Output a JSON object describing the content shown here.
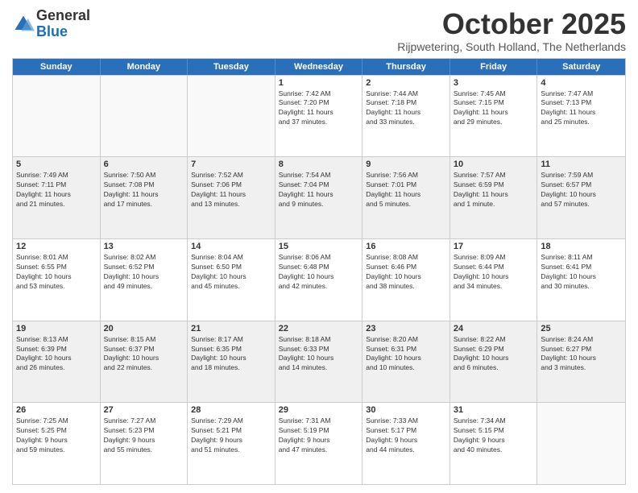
{
  "logo": {
    "general": "General",
    "blue": "Blue"
  },
  "title": "October 2025",
  "location": "Rijpwetering, South Holland, The Netherlands",
  "days": [
    "Sunday",
    "Monday",
    "Tuesday",
    "Wednesday",
    "Thursday",
    "Friday",
    "Saturday"
  ],
  "weeks": [
    [
      {
        "day": "",
        "content": ""
      },
      {
        "day": "",
        "content": ""
      },
      {
        "day": "",
        "content": ""
      },
      {
        "day": "1",
        "content": "Sunrise: 7:42 AM\nSunset: 7:20 PM\nDaylight: 11 hours\nand 37 minutes."
      },
      {
        "day": "2",
        "content": "Sunrise: 7:44 AM\nSunset: 7:18 PM\nDaylight: 11 hours\nand 33 minutes."
      },
      {
        "day": "3",
        "content": "Sunrise: 7:45 AM\nSunset: 7:15 PM\nDaylight: 11 hours\nand 29 minutes."
      },
      {
        "day": "4",
        "content": "Sunrise: 7:47 AM\nSunset: 7:13 PM\nDaylight: 11 hours\nand 25 minutes."
      }
    ],
    [
      {
        "day": "5",
        "content": "Sunrise: 7:49 AM\nSunset: 7:11 PM\nDaylight: 11 hours\nand 21 minutes."
      },
      {
        "day": "6",
        "content": "Sunrise: 7:50 AM\nSunset: 7:08 PM\nDaylight: 11 hours\nand 17 minutes."
      },
      {
        "day": "7",
        "content": "Sunrise: 7:52 AM\nSunset: 7:06 PM\nDaylight: 11 hours\nand 13 minutes."
      },
      {
        "day": "8",
        "content": "Sunrise: 7:54 AM\nSunset: 7:04 PM\nDaylight: 11 hours\nand 9 minutes."
      },
      {
        "day": "9",
        "content": "Sunrise: 7:56 AM\nSunset: 7:01 PM\nDaylight: 11 hours\nand 5 minutes."
      },
      {
        "day": "10",
        "content": "Sunrise: 7:57 AM\nSunset: 6:59 PM\nDaylight: 11 hours\nand 1 minute."
      },
      {
        "day": "11",
        "content": "Sunrise: 7:59 AM\nSunset: 6:57 PM\nDaylight: 10 hours\nand 57 minutes."
      }
    ],
    [
      {
        "day": "12",
        "content": "Sunrise: 8:01 AM\nSunset: 6:55 PM\nDaylight: 10 hours\nand 53 minutes."
      },
      {
        "day": "13",
        "content": "Sunrise: 8:02 AM\nSunset: 6:52 PM\nDaylight: 10 hours\nand 49 minutes."
      },
      {
        "day": "14",
        "content": "Sunrise: 8:04 AM\nSunset: 6:50 PM\nDaylight: 10 hours\nand 45 minutes."
      },
      {
        "day": "15",
        "content": "Sunrise: 8:06 AM\nSunset: 6:48 PM\nDaylight: 10 hours\nand 42 minutes."
      },
      {
        "day": "16",
        "content": "Sunrise: 8:08 AM\nSunset: 6:46 PM\nDaylight: 10 hours\nand 38 minutes."
      },
      {
        "day": "17",
        "content": "Sunrise: 8:09 AM\nSunset: 6:44 PM\nDaylight: 10 hours\nand 34 minutes."
      },
      {
        "day": "18",
        "content": "Sunrise: 8:11 AM\nSunset: 6:41 PM\nDaylight: 10 hours\nand 30 minutes."
      }
    ],
    [
      {
        "day": "19",
        "content": "Sunrise: 8:13 AM\nSunset: 6:39 PM\nDaylight: 10 hours\nand 26 minutes."
      },
      {
        "day": "20",
        "content": "Sunrise: 8:15 AM\nSunset: 6:37 PM\nDaylight: 10 hours\nand 22 minutes."
      },
      {
        "day": "21",
        "content": "Sunrise: 8:17 AM\nSunset: 6:35 PM\nDaylight: 10 hours\nand 18 minutes."
      },
      {
        "day": "22",
        "content": "Sunrise: 8:18 AM\nSunset: 6:33 PM\nDaylight: 10 hours\nand 14 minutes."
      },
      {
        "day": "23",
        "content": "Sunrise: 8:20 AM\nSunset: 6:31 PM\nDaylight: 10 hours\nand 10 minutes."
      },
      {
        "day": "24",
        "content": "Sunrise: 8:22 AM\nSunset: 6:29 PM\nDaylight: 10 hours\nand 6 minutes."
      },
      {
        "day": "25",
        "content": "Sunrise: 8:24 AM\nSunset: 6:27 PM\nDaylight: 10 hours\nand 3 minutes."
      }
    ],
    [
      {
        "day": "26",
        "content": "Sunrise: 7:25 AM\nSunset: 5:25 PM\nDaylight: 9 hours\nand 59 minutes."
      },
      {
        "day": "27",
        "content": "Sunrise: 7:27 AM\nSunset: 5:23 PM\nDaylight: 9 hours\nand 55 minutes."
      },
      {
        "day": "28",
        "content": "Sunrise: 7:29 AM\nSunset: 5:21 PM\nDaylight: 9 hours\nand 51 minutes."
      },
      {
        "day": "29",
        "content": "Sunrise: 7:31 AM\nSunset: 5:19 PM\nDaylight: 9 hours\nand 47 minutes."
      },
      {
        "day": "30",
        "content": "Sunrise: 7:33 AM\nSunset: 5:17 PM\nDaylight: 9 hours\nand 44 minutes."
      },
      {
        "day": "31",
        "content": "Sunrise: 7:34 AM\nSunset: 5:15 PM\nDaylight: 9 hours\nand 40 minutes."
      },
      {
        "day": "",
        "content": ""
      }
    ]
  ]
}
